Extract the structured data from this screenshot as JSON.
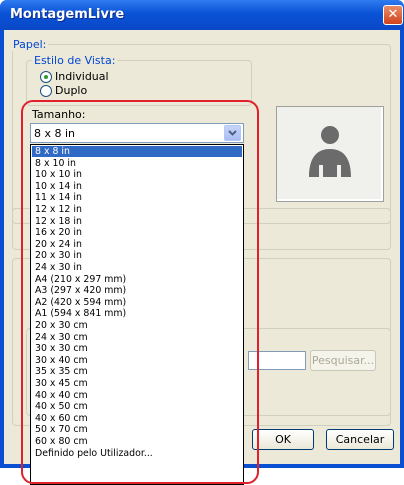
{
  "window": {
    "title": "MontagemLivre",
    "close_glyph": "✕"
  },
  "papel": {
    "group_label": "Papel:",
    "estilo_label": "Estilo de Vista:",
    "options": [
      "Individual",
      "Duplo"
    ],
    "selected": "Individual"
  },
  "tamanho": {
    "label": "Tamanho:",
    "selected_value": "8 x 8 in",
    "options": [
      "8 x 8 in",
      "8 x 10 in",
      "10 x 10 in",
      "10 x 14 in",
      "11 x 14 in",
      "12 x 12 in",
      "12 x 18 in",
      "16 x 20 in",
      "20 x 24 in",
      "20 x 30 in",
      "24 x 30 in",
      "A4 (210 x 297 mm)",
      "A3 (297 x 420 mm)",
      "A2 (420 x 594 mm)",
      "A1 (594 x 841 mm)",
      "20 x 30 cm",
      "24 x 30 cm",
      "30 x 30 cm",
      "30 x 40 cm",
      "35 x 35 cm",
      "30 x 45 cm",
      "40 x 40 cm",
      "40 x 50 cm",
      "40 x 60 cm",
      "50 x 70 cm",
      "60 x 80 cm",
      "Definido pelo Utilizador..."
    ]
  },
  "buttons": {
    "browse": "Pesquisar...",
    "ok": "OK",
    "cancel": "Cancelar"
  },
  "preview": {
    "icon": "person-icon"
  }
}
